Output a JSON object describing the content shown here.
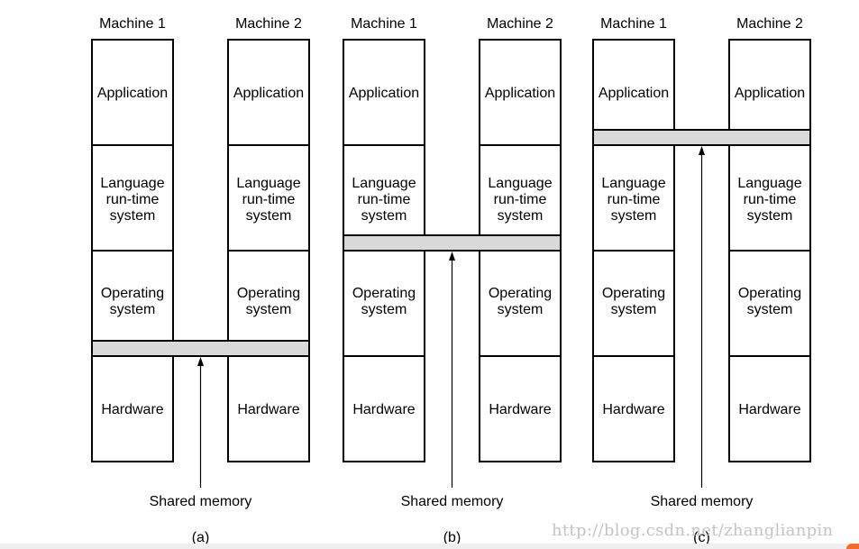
{
  "layers": [
    "Application",
    "Language\nrun-time\nsystem",
    "Operating\nsystem",
    "Hardware"
  ],
  "panels": [
    {
      "label": "(a)",
      "machines": [
        "Machine 1",
        "Machine 2"
      ],
      "shared_memory_label": "Shared memory",
      "shared_between_layers": [
        "Operating system",
        "Hardware"
      ]
    },
    {
      "label": "(b)",
      "machines": [
        "Machine 1",
        "Machine 2"
      ],
      "shared_memory_label": "Shared memory",
      "shared_between_layers": [
        "Language run-time system",
        "Operating system"
      ]
    },
    {
      "label": "(c)",
      "machines": [
        "Machine 1",
        "Machine 2"
      ],
      "shared_memory_label": "Shared memory",
      "shared_between_layers": [
        "Application",
        "Language run-time system"
      ]
    }
  ],
  "watermark": "http://blog.csdn.net/zhanglianpin",
  "colors": {
    "shared_memory_fill": "#d9d9d9",
    "stroke": "#000000",
    "watermark": "#d8d8d8"
  }
}
